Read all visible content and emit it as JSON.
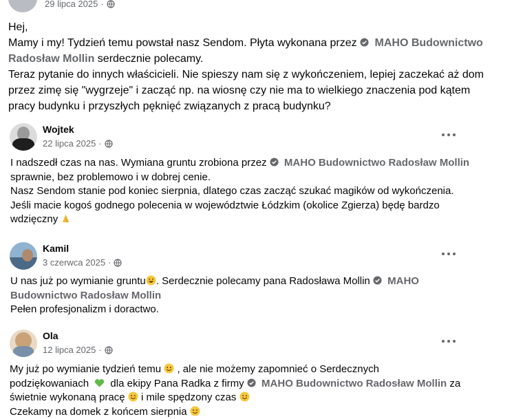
{
  "top_post": {
    "date": "29 lipca 2025",
    "lines": [
      "Hej,",
      "Mamy i my! Tydzień temu powstał nasz Sendom. Płyta wykonana przez",
      "MAHO Budownictwo",
      "Radosław Mollin",
      "serdecznie polecamy.",
      "Teraz pytanie do innych właścicieli. Nie spieszy nam się z wykończeniem, lepiej zaczekać aż dom",
      "przez zimę się \"wygrzeje\" i zacząć np. na wiosnę czy nie ma to wielkiego znaczenia pod kątem",
      "pracy budynku i przyszłych pęknięć związanych z pracą budynku?"
    ]
  },
  "comments": [
    {
      "name": "Wojtek",
      "date": "22 lipca 2025",
      "lines": [
        "I nadszedł czas na nas. Wymiana gruntu zrobiona przez",
        "MAHO Budownictwo Radosław Mollin",
        "sprawnie, bez problemowo i w dobrej cenie.",
        "Nasz Sendom stanie pod koniec sierpnia, dlatego czas zacząć szukać magików od wykończenia.",
        "Jeśli macie kogoś godnego polecenia w województwie Łódzkim (okolice Zgierza) będę bardzo",
        "wdzięczny"
      ]
    },
    {
      "name": "Kamil",
      "date": "3 czerwca 2025",
      "lines": [
        "U nas już po wymianie gruntu",
        ". Serdecznie polecamy pana Radosława Mollin",
        "MAHO",
        "Budownictwo Radosław Mollin",
        "Pełen profesjonalizm i doractwo."
      ]
    },
    {
      "name": "Ola",
      "date": "12 lipca 2025",
      "lines": [
        "My już po wymianie tydzień temu",
        ", ale nie możemy zapomnieć  o Serdecznych",
        "podziękowaniach",
        "dla ekipy Pana Radka z firmy",
        "MAHO Budownictwo Radosław Mollin",
        "za",
        "świetnie wykonaną pracę",
        "i mile spędzony czas",
        "Czekamy na domek z końcem sierpnia"
      ]
    }
  ],
  "separator": "·",
  "icons": {
    "globe": "globe-icon",
    "verified": "verified-badge-icon",
    "more": "more-options-icon",
    "emoji_smile": "smiling-face-icon",
    "emoji_grin": "grinning-face-icon",
    "emoji_pray": "folded-hands-icon",
    "emoji_heart": "green-heart-icon"
  },
  "colors": {
    "link": "#65676b",
    "meta": "#65676b",
    "text": "#050505",
    "heart": "#5dbb46"
  }
}
